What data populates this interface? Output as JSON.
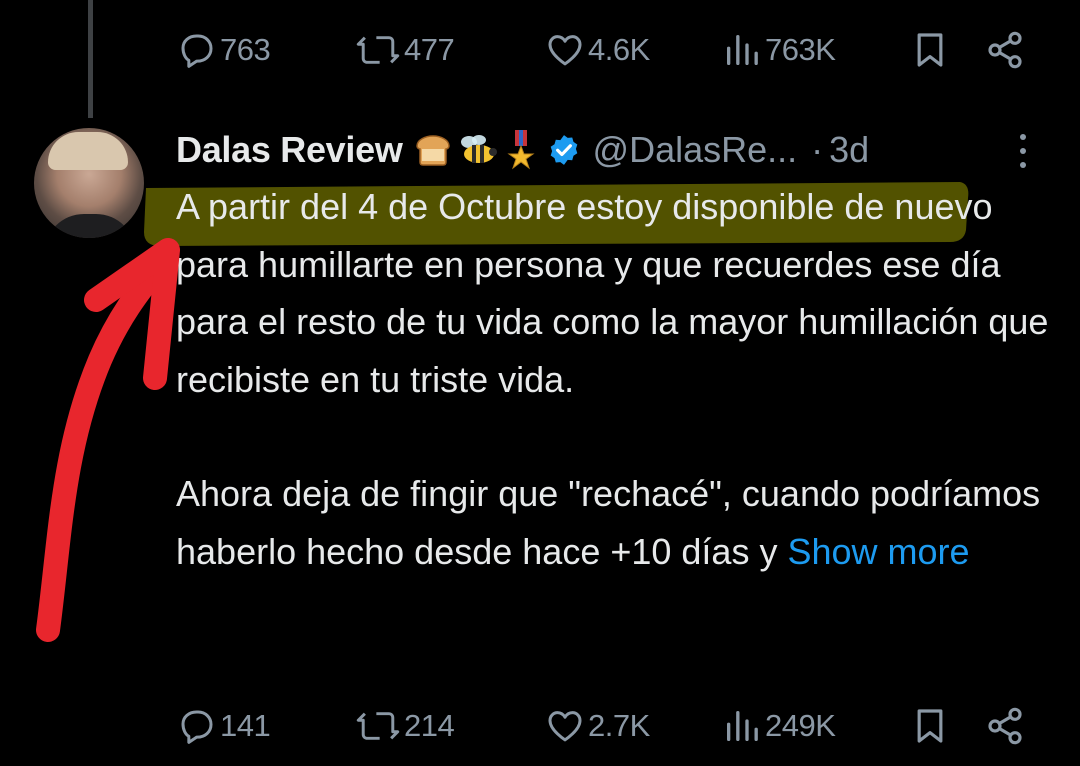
{
  "top_actions": {
    "replies": "763",
    "reposts": "477",
    "likes": "4.6K",
    "views": "763K"
  },
  "tweet": {
    "display_name": "Dalas Review",
    "name_emojis": [
      "bread-emoji",
      "bee-emoji",
      "medal-emoji"
    ],
    "verified": true,
    "handle": "@DalasRe...",
    "separator": "·",
    "time": "3d",
    "paragraph_1": "A partir del 4 de Octubre estoy disponible de nuevo para humillarte en persona y que recuerdes ese día para el resto de tu vida como la mayor humillación que recibiste en tu triste vida.",
    "paragraph_2": "Ahora deja de fingir que \"rechacé\", cuando podríamos haberlo hecho desde hace +10 días y",
    "show_more": "Show more"
  },
  "bottom_actions": {
    "replies": "141",
    "reposts": "214",
    "likes": "2.7K",
    "views": "249K"
  },
  "colors": {
    "background": "#000000",
    "text": "#e7e9ea",
    "secondary": "#8b98a5",
    "link": "#1d9bf0",
    "verified_badge": "#1d9bf0",
    "highlight": "#f0f000",
    "annotation_arrow": "#e8262d"
  }
}
